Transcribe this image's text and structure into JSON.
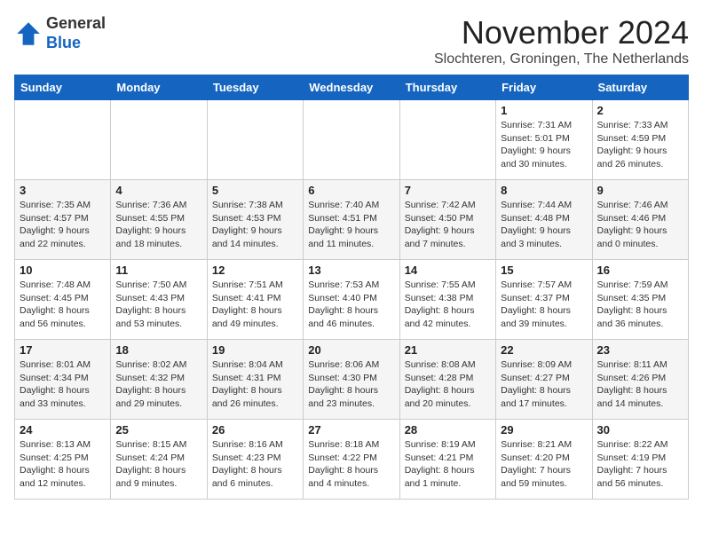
{
  "logo": {
    "general": "General",
    "blue": "Blue"
  },
  "title": "November 2024",
  "location": "Slochteren, Groningen, The Netherlands",
  "weekdays": [
    "Sunday",
    "Monday",
    "Tuesday",
    "Wednesday",
    "Thursday",
    "Friday",
    "Saturday"
  ],
  "weeks": [
    [
      {
        "day": "",
        "info": ""
      },
      {
        "day": "",
        "info": ""
      },
      {
        "day": "",
        "info": ""
      },
      {
        "day": "",
        "info": ""
      },
      {
        "day": "",
        "info": ""
      },
      {
        "day": "1",
        "info": "Sunrise: 7:31 AM\nSunset: 5:01 PM\nDaylight: 9 hours and 30 minutes."
      },
      {
        "day": "2",
        "info": "Sunrise: 7:33 AM\nSunset: 4:59 PM\nDaylight: 9 hours and 26 minutes."
      }
    ],
    [
      {
        "day": "3",
        "info": "Sunrise: 7:35 AM\nSunset: 4:57 PM\nDaylight: 9 hours and 22 minutes."
      },
      {
        "day": "4",
        "info": "Sunrise: 7:36 AM\nSunset: 4:55 PM\nDaylight: 9 hours and 18 minutes."
      },
      {
        "day": "5",
        "info": "Sunrise: 7:38 AM\nSunset: 4:53 PM\nDaylight: 9 hours and 14 minutes."
      },
      {
        "day": "6",
        "info": "Sunrise: 7:40 AM\nSunset: 4:51 PM\nDaylight: 9 hours and 11 minutes."
      },
      {
        "day": "7",
        "info": "Sunrise: 7:42 AM\nSunset: 4:50 PM\nDaylight: 9 hours and 7 minutes."
      },
      {
        "day": "8",
        "info": "Sunrise: 7:44 AM\nSunset: 4:48 PM\nDaylight: 9 hours and 3 minutes."
      },
      {
        "day": "9",
        "info": "Sunrise: 7:46 AM\nSunset: 4:46 PM\nDaylight: 9 hours and 0 minutes."
      }
    ],
    [
      {
        "day": "10",
        "info": "Sunrise: 7:48 AM\nSunset: 4:45 PM\nDaylight: 8 hours and 56 minutes."
      },
      {
        "day": "11",
        "info": "Sunrise: 7:50 AM\nSunset: 4:43 PM\nDaylight: 8 hours and 53 minutes."
      },
      {
        "day": "12",
        "info": "Sunrise: 7:51 AM\nSunset: 4:41 PM\nDaylight: 8 hours and 49 minutes."
      },
      {
        "day": "13",
        "info": "Sunrise: 7:53 AM\nSunset: 4:40 PM\nDaylight: 8 hours and 46 minutes."
      },
      {
        "day": "14",
        "info": "Sunrise: 7:55 AM\nSunset: 4:38 PM\nDaylight: 8 hours and 42 minutes."
      },
      {
        "day": "15",
        "info": "Sunrise: 7:57 AM\nSunset: 4:37 PM\nDaylight: 8 hours and 39 minutes."
      },
      {
        "day": "16",
        "info": "Sunrise: 7:59 AM\nSunset: 4:35 PM\nDaylight: 8 hours and 36 minutes."
      }
    ],
    [
      {
        "day": "17",
        "info": "Sunrise: 8:01 AM\nSunset: 4:34 PM\nDaylight: 8 hours and 33 minutes."
      },
      {
        "day": "18",
        "info": "Sunrise: 8:02 AM\nSunset: 4:32 PM\nDaylight: 8 hours and 29 minutes."
      },
      {
        "day": "19",
        "info": "Sunrise: 8:04 AM\nSunset: 4:31 PM\nDaylight: 8 hours and 26 minutes."
      },
      {
        "day": "20",
        "info": "Sunrise: 8:06 AM\nSunset: 4:30 PM\nDaylight: 8 hours and 23 minutes."
      },
      {
        "day": "21",
        "info": "Sunrise: 8:08 AM\nSunset: 4:28 PM\nDaylight: 8 hours and 20 minutes."
      },
      {
        "day": "22",
        "info": "Sunrise: 8:09 AM\nSunset: 4:27 PM\nDaylight: 8 hours and 17 minutes."
      },
      {
        "day": "23",
        "info": "Sunrise: 8:11 AM\nSunset: 4:26 PM\nDaylight: 8 hours and 14 minutes."
      }
    ],
    [
      {
        "day": "24",
        "info": "Sunrise: 8:13 AM\nSunset: 4:25 PM\nDaylight: 8 hours and 12 minutes."
      },
      {
        "day": "25",
        "info": "Sunrise: 8:15 AM\nSunset: 4:24 PM\nDaylight: 8 hours and 9 minutes."
      },
      {
        "day": "26",
        "info": "Sunrise: 8:16 AM\nSunset: 4:23 PM\nDaylight: 8 hours and 6 minutes."
      },
      {
        "day": "27",
        "info": "Sunrise: 8:18 AM\nSunset: 4:22 PM\nDaylight: 8 hours and 4 minutes."
      },
      {
        "day": "28",
        "info": "Sunrise: 8:19 AM\nSunset: 4:21 PM\nDaylight: 8 hours and 1 minute."
      },
      {
        "day": "29",
        "info": "Sunrise: 8:21 AM\nSunset: 4:20 PM\nDaylight: 7 hours and 59 minutes."
      },
      {
        "day": "30",
        "info": "Sunrise: 8:22 AM\nSunset: 4:19 PM\nDaylight: 7 hours and 56 minutes."
      }
    ]
  ]
}
